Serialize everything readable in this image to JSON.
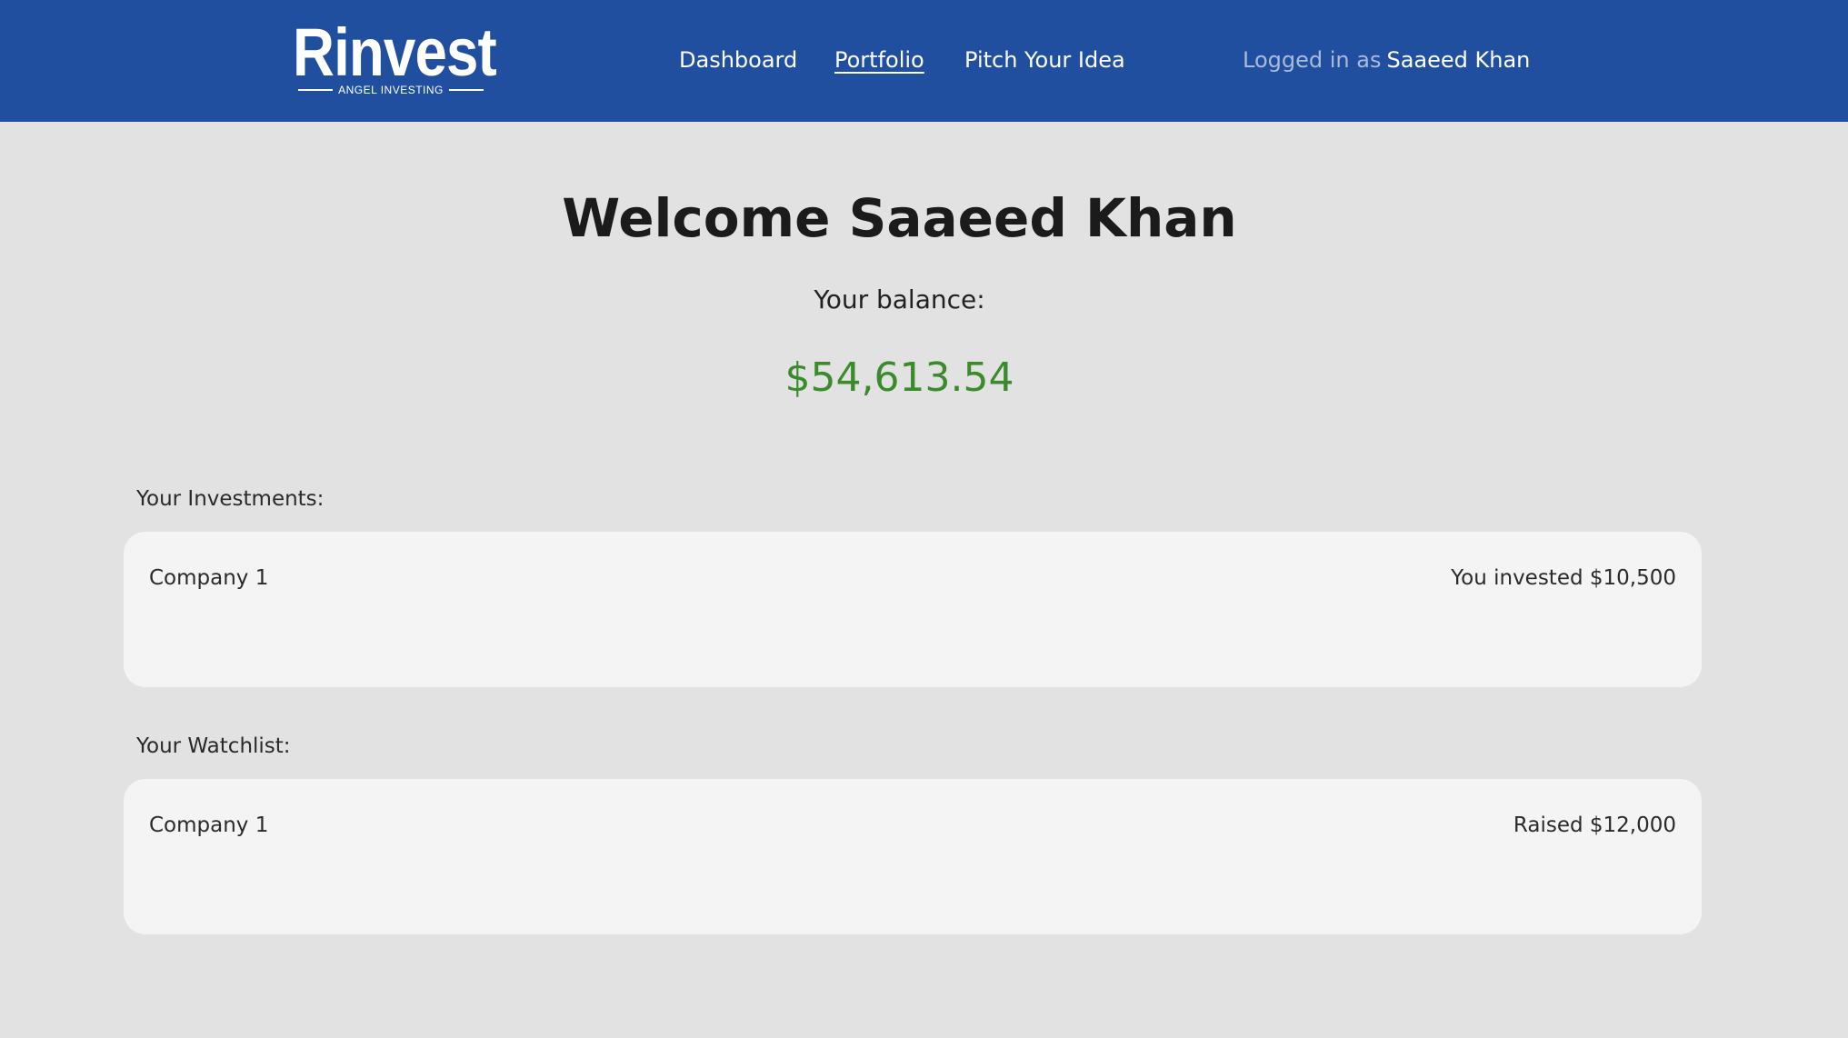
{
  "header": {
    "logo": {
      "wordmark": "Rinvest",
      "tagline": "ANGEL INVESTING"
    },
    "nav": [
      {
        "label": "Dashboard",
        "active": false
      },
      {
        "label": "Portfolio",
        "active": true
      },
      {
        "label": "Pitch Your Idea",
        "active": false
      }
    ],
    "login": {
      "prefix": "Logged in as",
      "username": "Saaeed Khan"
    }
  },
  "main": {
    "welcome": "Welcome Saaeed Khan",
    "balance_label": "Your balance:",
    "balance_value": "$54,613.54",
    "investments": {
      "label": "Your Investments:",
      "items": [
        {
          "company": "Company 1",
          "amount": "You invested $10,500"
        }
      ]
    },
    "watchlist": {
      "label": "Your Watchlist:",
      "items": [
        {
          "company": "Company 1",
          "amount": "Raised $12,000"
        }
      ]
    }
  },
  "colors": {
    "nav_background": "#214fa0",
    "page_background": "#e2e2e2",
    "card_background": "#f4f4f4",
    "balance_green": "#3b8a2c",
    "muted_login_text": "#a9badb"
  }
}
